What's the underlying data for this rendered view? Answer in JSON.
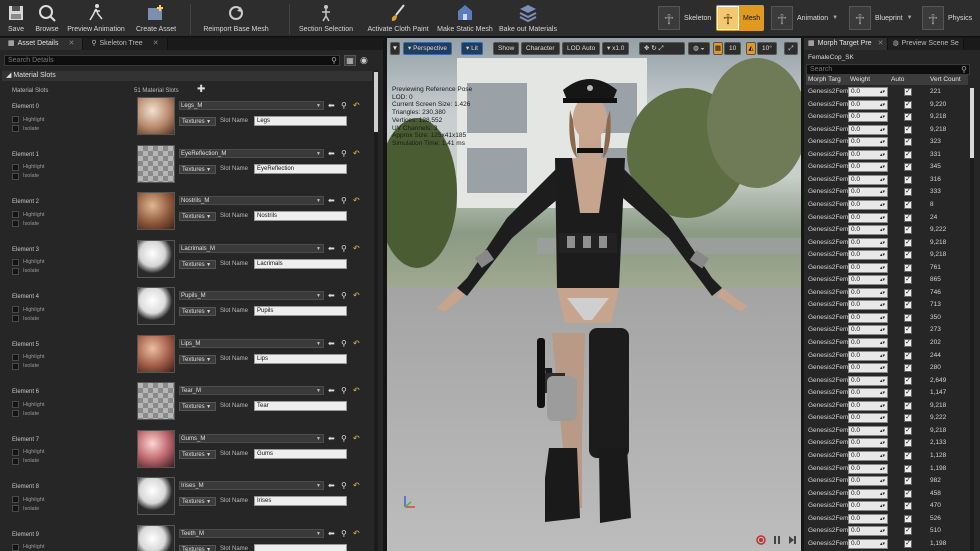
{
  "toolbar": {
    "save": "Save",
    "browse": "Browse",
    "preview_animation": "Preview Animation",
    "create_asset": "Create Asset",
    "reimport": "Reimport Base Mesh",
    "section_selection": "Section Selection",
    "cloth_paint": "Activate Cloth Paint",
    "make_static": "Make Static Mesh",
    "bake_materials": "Bake out Materials",
    "modes": {
      "skeleton": "Skeleton",
      "mesh": "Mesh",
      "animation": "Animation",
      "blueprint": "Blueprint",
      "physics": "Physics"
    },
    "accent": "#e09a1f"
  },
  "left": {
    "tabs": [
      "Asset Details",
      "Skeleton Tree"
    ],
    "search_placeholder": "Search Details",
    "category": "Material Slots",
    "col_slots": "Material Slots",
    "count_label": "51 Material Slots",
    "highlight": "Highlight",
    "isolate": "Isolate",
    "textures": "Textures",
    "slot_name": "Slot Name",
    "elements": [
      {
        "name": "Element 0",
        "material": "Legs_M",
        "slot": "Legs"
      },
      {
        "name": "Element 1",
        "material": "EyeReflection_M",
        "slot": "EyeReflection"
      },
      {
        "name": "Element 2",
        "material": "Nostrils_M",
        "slot": "Nostrils"
      },
      {
        "name": "Element 3",
        "material": "Lacrimals_M",
        "slot": "Lacrimals"
      },
      {
        "name": "Element 4",
        "material": "Pupils_M",
        "slot": "Pupils"
      },
      {
        "name": "Element 5",
        "material": "Lips_M",
        "slot": "Lips"
      },
      {
        "name": "Element 6",
        "material": "Tear_M",
        "slot": "Tear"
      },
      {
        "name": "Element 7",
        "material": "Gums_M",
        "slot": "Gums"
      },
      {
        "name": "Element 8",
        "material": "Irises_M",
        "slot": "Irises"
      },
      {
        "name": "Element 9",
        "material": "Teeth_M",
        "slot": ""
      }
    ]
  },
  "viewport": {
    "perspective": "Perspective",
    "lit": "Lit",
    "show": "Show",
    "character": "Character",
    "lod": "LOD Auto",
    "speed": "x1.0",
    "grid": "10",
    "angle": "10°",
    "stats": [
      "Previewing Reference Pose",
      "LOD: 0",
      "Current Screen Size: 1.426",
      "Triangles: 230,380",
      "Vertices: 128,552",
      "UV Channels: 3",
      "Approx Size: 125x41x185",
      "Simulation Time: 1.41 ms"
    ]
  },
  "right": {
    "tabs": [
      "Morph Target Pre",
      "Preview Scene Se"
    ],
    "asset_name": "FemaleCop_SK",
    "search_placeholder": "Search",
    "cols": {
      "name": "Morph Targ",
      "weight": "Weight",
      "auto": "Auto",
      "verts": "Vert Count"
    },
    "row_name": "Genesis2Fem",
    "weight": "0.0",
    "vert_counts": [
      "221",
      "9,220",
      "9,218",
      "9,218",
      "323",
      "331",
      "345",
      "316",
      "333",
      "8",
      "24",
      "9,222",
      "9,218",
      "9,218",
      "761",
      "865",
      "746",
      "713",
      "350",
      "273",
      "202",
      "244",
      "280",
      "2,649",
      "1,147",
      "9,218",
      "9,222",
      "9,218",
      "2,133",
      "1,128",
      "1,198",
      "982",
      "458",
      "470",
      "526",
      "510",
      "1,198"
    ]
  }
}
